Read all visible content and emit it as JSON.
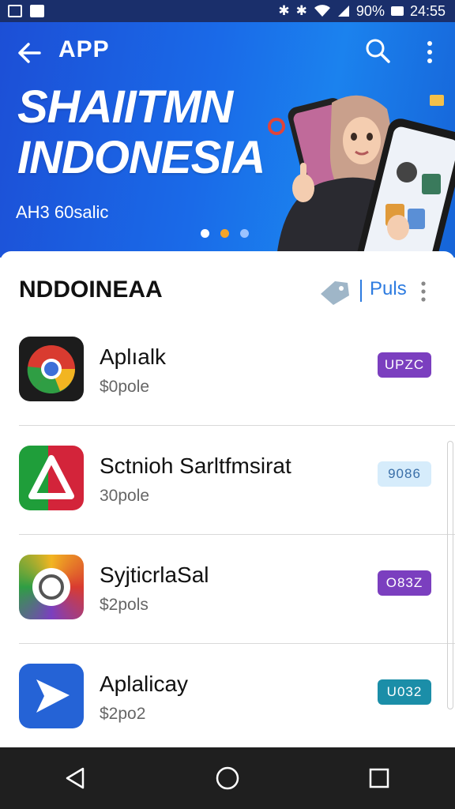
{
  "status": {
    "battery": "90%",
    "time": "24:55"
  },
  "appbar": {
    "title": "APP"
  },
  "banner": {
    "headline_line1": "SHAIITMN",
    "headline_line2": "INDONESIA",
    "subtitle": "AH3 60salic"
  },
  "section": {
    "title": "NDDOINEAA",
    "plus_label": "Puls"
  },
  "apps": [
    {
      "name": "Aplıalk",
      "price": "$0pole",
      "badge": "UPZC",
      "badge_color": "#7b3fbf",
      "icon": "chrome-icon"
    },
    {
      "name": "Sctnioh Sarltfmsirat",
      "price": "30pole",
      "badge": "9086",
      "badge_color": "#d6ecfb",
      "icon": "delta-icon"
    },
    {
      "name": "SyjticrlaSal",
      "price": "$2pols",
      "badge": "O83Z",
      "badge_color": "#7b3fbf",
      "icon": "gear-icon"
    },
    {
      "name": "Aplalicay",
      "price": "$2po2",
      "badge": "U032",
      "badge_color": "#1b8ea8",
      "icon": "send-icon"
    }
  ],
  "colors": {
    "banner": "#1a6ae8",
    "accent": "#2d7be0",
    "navbar": "#1f1f1f"
  }
}
